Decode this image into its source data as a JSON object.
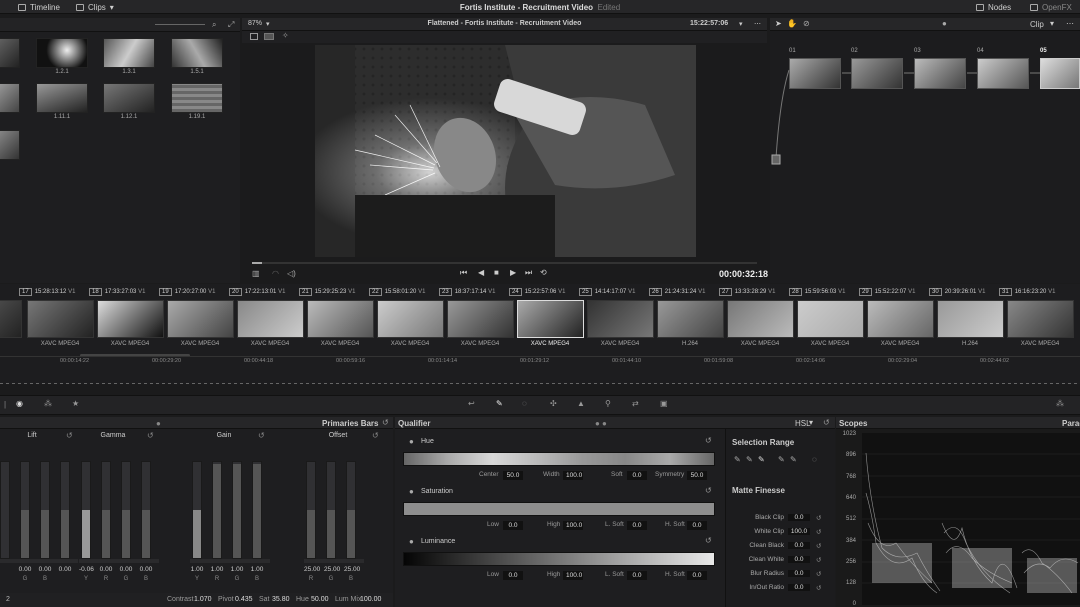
{
  "app": {
    "timeline_label": "Timeline",
    "clips_label": "Clips",
    "project_title": "Fortis Institute - Recruitment Video",
    "edited_label": "Edited",
    "nodes_label": "Nodes",
    "openfx_label": "OpenFX"
  },
  "pool": {
    "items": [
      {
        "label": ""
      },
      {
        "label": "1.2.1"
      },
      {
        "label": "1.3.1"
      },
      {
        "label": "1.5.1"
      },
      {
        "label": ""
      },
      {
        "label": "1.11.1"
      },
      {
        "label": "1.12.1"
      },
      {
        "label": "1.19.1"
      },
      {
        "label": ""
      }
    ]
  },
  "viewer": {
    "zoom": "87%",
    "title": "Flattened - Fortis Institute - Recruitment Video",
    "timecode": "15:22:57:06",
    "playhead_timecode": "00:00:32:18",
    "progress": 0.02
  },
  "nodes_panel": {
    "mode": "Clip",
    "nodes": [
      {
        "num": "01"
      },
      {
        "num": "02"
      },
      {
        "num": "03"
      },
      {
        "num": "04"
      },
      {
        "num": "05"
      }
    ]
  },
  "timeline": {
    "clips": [
      {
        "num": "17",
        "tc": "15:28:13:12",
        "track": "V1",
        "codec": "XAVC MPEG4"
      },
      {
        "num": "18",
        "tc": "17:33:27:03",
        "track": "V1",
        "codec": "XAVC MPEG4"
      },
      {
        "num": "19",
        "tc": "17:20:27:00",
        "track": "V1",
        "codec": "XAVC MPEG4"
      },
      {
        "num": "20",
        "tc": "17:22:13:01",
        "track": "V1",
        "codec": "XAVC MPEG4"
      },
      {
        "num": "21",
        "tc": "15:29:25:23",
        "track": "V1",
        "codec": "XAVC MPEG4"
      },
      {
        "num": "22",
        "tc": "15:58:01:20",
        "track": "V1",
        "codec": "XAVC MPEG4"
      },
      {
        "num": "23",
        "tc": "18:37:17:14",
        "track": "V1",
        "codec": "XAVC MPEG4"
      },
      {
        "num": "24",
        "tc": "15:22:57:06",
        "track": "V1",
        "codec": "XAVC MPEG4"
      },
      {
        "num": "25",
        "tc": "14:14:17:07",
        "track": "V1",
        "codec": "XAVC MPEG4"
      },
      {
        "num": "26",
        "tc": "21:24:31:24",
        "track": "V1",
        "codec": "H.264"
      },
      {
        "num": "27",
        "tc": "13:33:28:29",
        "track": "V1",
        "codec": "XAVC MPEG4"
      },
      {
        "num": "28",
        "tc": "15:59:56:03",
        "track": "V1",
        "codec": "XAVC MPEG4"
      },
      {
        "num": "29",
        "tc": "15:52:22:07",
        "track": "V1",
        "codec": "XAVC MPEG4"
      },
      {
        "num": "30",
        "tc": "20:39:26:01",
        "track": "V1",
        "codec": "H.264"
      },
      {
        "num": "31",
        "tc": "16:16:23:20",
        "track": "V1",
        "codec": "XAVC MPEG4"
      }
    ],
    "ruler": [
      "00:00:14:22",
      "00:00:29:20",
      "00:00:44:18",
      "00:00:59:16",
      "00:01:14:14",
      "00:01:29:12",
      "00:01:44:10",
      "00:01:59:08",
      "00:02:14:06",
      "00:02:29:04",
      "00:02:44:02"
    ]
  },
  "primaries": {
    "panel_title": "Primaries Bars",
    "wheels": [
      {
        "name": "Lift",
        "values": [
          "",
          "0.00",
          "0.00",
          "0.00"
        ],
        "channels": [
          "",
          "G",
          "B",
          ""
        ]
      },
      {
        "name": "Gamma",
        "values": [
          "-0.06",
          "0.00",
          "0.00",
          "0.00"
        ],
        "channels": [
          "Y",
          "R",
          "G",
          "B"
        ]
      },
      {
        "name": "Gain",
        "values": [
          "1.00",
          "1.00",
          "1.00",
          "1.00"
        ],
        "channels": [
          "Y",
          "R",
          "G",
          "B"
        ]
      },
      {
        "name": "Offset",
        "values": [
          "25.00",
          "25.00",
          "25.00"
        ],
        "channels": [
          "R",
          "G",
          "B"
        ]
      }
    ],
    "footer": {
      "page": "2",
      "contrast_label": "Contrast",
      "contrast": "1.070",
      "pivot_label": "Pivot",
      "pivot": "0.435",
      "sat_label": "Sat",
      "sat": "35.80",
      "hue_label": "Hue",
      "hue": "50.00",
      "lummix_label": "Lum Mix",
      "lummix": "100.00"
    }
  },
  "qualifier": {
    "panel_title": "Qualifier",
    "mode": "HSL",
    "hue": {
      "label": "Hue",
      "center_label": "Center",
      "center": "50.0",
      "width_label": "Width",
      "width": "100.0",
      "soft_label": "Soft",
      "soft": "0.0",
      "symmetry_label": "Symmetry",
      "symmetry": "50.0"
    },
    "saturation": {
      "label": "Saturation",
      "low_label": "Low",
      "low": "0.0",
      "high_label": "High",
      "high": "100.0",
      "lsoft_label": "L. Soft",
      "lsoft": "0.0",
      "hsoft_label": "H. Soft",
      "hsoft": "0.0"
    },
    "luminance": {
      "label": "Luminance",
      "low_label": "Low",
      "low": "0.0",
      "high_label": "High",
      "high": "100.0",
      "lsoft_label": "L. Soft",
      "lsoft": "0.0",
      "hsoft_label": "H. Soft",
      "hsoft": "0.0"
    },
    "selection_range_label": "Selection Range",
    "matte_finesse_label": "Matte Finesse",
    "matte": [
      {
        "label": "Black Clip",
        "value": "0.0"
      },
      {
        "label": "White Clip",
        "value": "100.0"
      },
      {
        "label": "Clean Black",
        "value": "0.0"
      },
      {
        "label": "Clean White",
        "value": "0.0"
      },
      {
        "label": "Blur Radius",
        "value": "0.0"
      },
      {
        "label": "In/Out Ratio",
        "value": "0.0"
      }
    ]
  },
  "scopes": {
    "title": "Scopes",
    "mode": "Parad",
    "axis": [
      "1023",
      "896",
      "768",
      "640",
      "512",
      "384",
      "256",
      "128",
      "0"
    ]
  }
}
